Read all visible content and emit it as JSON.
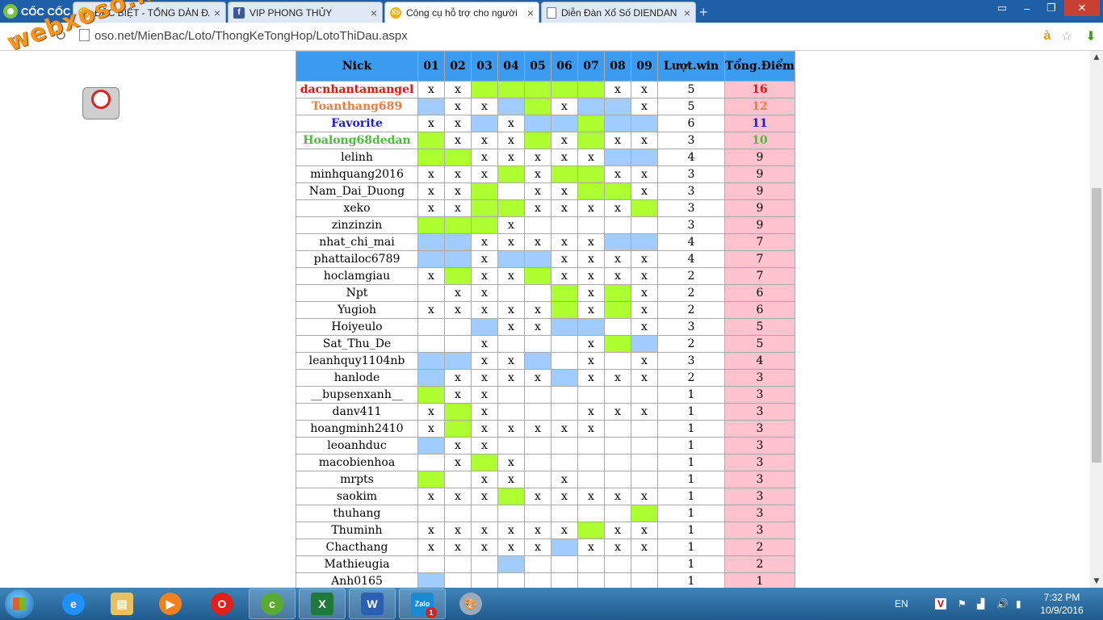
{
  "browser": {
    "brand_name": "CỐC CỐC",
    "tabs": [
      {
        "title": "ĐẶC BIỆT - TỔNG DÀN ĐẶ",
        "icon": "xoso-favicon-icon",
        "active": false
      },
      {
        "title": "VIP PHONG THỦY",
        "icon": "facebook-favicon-icon",
        "active": false
      },
      {
        "title": "Công cụ hỗ trợ cho người",
        "icon": "xoso-favicon-icon",
        "active": true
      },
      {
        "title": "Diễn Đàn Xổ Số DIENDAN",
        "icon": "page-icon",
        "active": false
      }
    ],
    "url": "oso.net/MienBac/Loto/ThongKeTongHop/LotoThiDau.aspx"
  },
  "watermark": "webxoso.net",
  "table": {
    "headers": [
      "Nick",
      "01",
      "02",
      "03",
      "04",
      "05",
      "06",
      "07",
      "08",
      "09",
      "Lượt.win",
      "Tổng.Điểm"
    ],
    "rows": [
      {
        "nick": "dacnhantamangel",
        "style": "red",
        "cells": [
          "x",
          "x",
          "",
          "",
          "",
          "",
          "",
          "x",
          "x"
        ],
        "fills": [
          "",
          "",
          "g",
          "g",
          "g",
          "g",
          "g",
          "",
          ""
        ],
        "win": "5",
        "points": "16"
      },
      {
        "nick": "Toanthang689",
        "style": "orange",
        "cells": [
          "",
          "x",
          "x",
          "",
          "",
          "x",
          "",
          "",
          "x"
        ],
        "fills": [
          "b",
          "",
          "",
          "b",
          "g",
          "",
          "b",
          "b",
          ""
        ],
        "win": "5",
        "points": "12"
      },
      {
        "nick": "Favorite",
        "style": "blue",
        "cells": [
          "x",
          "x",
          "",
          "x",
          "",
          "",
          "",
          "",
          ""
        ],
        "fills": [
          "",
          "",
          "b",
          "",
          "b",
          "b",
          "g",
          "b",
          "b"
        ],
        "win": "6",
        "points": "11"
      },
      {
        "nick": "Hoalong68dedan",
        "style": "green",
        "cells": [
          "",
          "x",
          "x",
          "x",
          "",
          "x",
          "",
          "x",
          "x"
        ],
        "fills": [
          "g",
          "",
          "",
          "",
          "g",
          "",
          "g",
          "",
          ""
        ],
        "win": "3",
        "points": "10"
      },
      {
        "nick": "lelinh",
        "style": "",
        "cells": [
          "",
          "",
          "x",
          "x",
          "x",
          "x",
          "x",
          "",
          ""
        ],
        "fills": [
          "g",
          "g",
          "",
          "",
          "",
          "",
          "",
          "b",
          "b"
        ],
        "win": "4",
        "points": "9"
      },
      {
        "nick": "minhquang2016",
        "style": "",
        "cells": [
          "x",
          "x",
          "x",
          "",
          "x",
          "",
          "",
          "x",
          "x"
        ],
        "fills": [
          "",
          "",
          "",
          "g",
          "",
          "g",
          "g",
          "",
          ""
        ],
        "win": "3",
        "points": "9"
      },
      {
        "nick": "Nam_Dai_Duong",
        "style": "",
        "cells": [
          "x",
          "x",
          "",
          "",
          "x",
          "x",
          "",
          "",
          "x"
        ],
        "fills": [
          "",
          "",
          "g",
          "",
          "",
          "",
          "g",
          "g",
          ""
        ],
        "win": "3",
        "points": "9"
      },
      {
        "nick": "xeko",
        "style": "",
        "cells": [
          "x",
          "x",
          "",
          "",
          "x",
          "x",
          "x",
          "x",
          ""
        ],
        "fills": [
          "",
          "",
          "g",
          "g",
          "",
          "",
          "",
          "",
          "g"
        ],
        "win": "3",
        "points": "9"
      },
      {
        "nick": "zinzinzin",
        "style": "",
        "cells": [
          "",
          "",
          "",
          "x",
          "",
          "",
          "",
          "",
          ""
        ],
        "fills": [
          "g",
          "g",
          "g",
          "",
          "",
          "",
          "",
          "",
          ""
        ],
        "win": "3",
        "points": "9"
      },
      {
        "nick": "nhat_chi_mai",
        "style": "",
        "cells": [
          "",
          "",
          "x",
          "x",
          "x",
          "x",
          "x",
          "",
          ""
        ],
        "fills": [
          "b",
          "b",
          "",
          "",
          "",
          "",
          "",
          "b",
          "b"
        ],
        "win": "4",
        "points": "7"
      },
      {
        "nick": "phattailoc6789",
        "style": "",
        "cells": [
          "",
          "",
          "x",
          "",
          "",
          "x",
          "x",
          "x",
          "x"
        ],
        "fills": [
          "b",
          "b",
          "",
          "b",
          "b",
          "",
          "",
          "",
          ""
        ],
        "win": "4",
        "points": "7"
      },
      {
        "nick": "hoclamgiau",
        "style": "",
        "cells": [
          "x",
          "",
          "x",
          "x",
          "",
          "x",
          "x",
          "x",
          "x"
        ],
        "fills": [
          "",
          "g",
          "",
          "",
          "g",
          "",
          "",
          "",
          ""
        ],
        "win": "2",
        "points": "7"
      },
      {
        "nick": "Npt",
        "style": "",
        "cells": [
          "",
          "x",
          "x",
          "",
          "",
          "",
          "x",
          "",
          "x"
        ],
        "fills": [
          "",
          "",
          "",
          "",
          "",
          "g",
          "",
          "g",
          ""
        ],
        "win": "2",
        "points": "6"
      },
      {
        "nick": "Yugioh",
        "style": "",
        "cells": [
          "x",
          "x",
          "x",
          "x",
          "x",
          "",
          "x",
          "",
          "x"
        ],
        "fills": [
          "",
          "",
          "",
          "",
          "",
          "g",
          "",
          "g",
          ""
        ],
        "win": "2",
        "points": "6"
      },
      {
        "nick": "Hoiyeulo",
        "style": "",
        "cells": [
          "",
          "",
          "",
          "x",
          "x",
          "",
          "",
          "",
          "x"
        ],
        "fills": [
          "",
          "",
          "b",
          "",
          "",
          "b",
          "b",
          "",
          ""
        ],
        "win": "3",
        "points": "5"
      },
      {
        "nick": "Sat_Thu_De",
        "style": "",
        "cells": [
          "",
          "",
          "x",
          "",
          "",
          "",
          "x",
          "",
          ""
        ],
        "fills": [
          "",
          "",
          "",
          "",
          "",
          "",
          "",
          "g",
          "b"
        ],
        "win": "2",
        "points": "5"
      },
      {
        "nick": "leanhquy1104nb",
        "style": "",
        "cells": [
          "",
          "",
          "x",
          "x",
          "",
          "",
          "x",
          "",
          "x"
        ],
        "fills": [
          "b",
          "b",
          "",
          "",
          "b",
          "",
          "",
          "",
          ""
        ],
        "win": "3",
        "points": "4"
      },
      {
        "nick": "hanlode",
        "style": "",
        "cells": [
          "",
          "x",
          "x",
          "x",
          "x",
          "",
          "x",
          "x",
          "x"
        ],
        "fills": [
          "b",
          "",
          "",
          "",
          "",
          "b",
          "",
          "",
          ""
        ],
        "win": "2",
        "points": "3"
      },
      {
        "nick": "__bupsenxanh__",
        "style": "",
        "cells": [
          "",
          "x",
          "x",
          "",
          "",
          "",
          "",
          "",
          ""
        ],
        "fills": [
          "g",
          "",
          "",
          "",
          "",
          "",
          "",
          "",
          ""
        ],
        "win": "1",
        "points": "3"
      },
      {
        "nick": "danv411",
        "style": "",
        "cells": [
          "x",
          "",
          "x",
          "",
          "",
          "",
          "x",
          "x",
          "x"
        ],
        "fills": [
          "",
          "g",
          "",
          "",
          "",
          "",
          "",
          "",
          ""
        ],
        "win": "1",
        "points": "3"
      },
      {
        "nick": "hoangminh2410",
        "style": "",
        "cells": [
          "x",
          "",
          "x",
          "x",
          "x",
          "x",
          "x",
          "",
          ""
        ],
        "fills": [
          "",
          "g",
          "",
          "",
          "",
          "",
          "",
          "",
          ""
        ],
        "win": "1",
        "points": "3"
      },
      {
        "nick": "leoanhduc",
        "style": "",
        "cells": [
          "",
          "x",
          "x",
          "",
          "",
          "",
          "",
          "",
          ""
        ],
        "fills": [
          "b",
          "",
          "",
          "",
          "",
          "",
          "",
          "",
          ""
        ],
        "win": "1",
        "points": "3"
      },
      {
        "nick": "macobienhoa",
        "style": "",
        "cells": [
          "",
          "x",
          "",
          "x",
          "",
          "",
          "",
          "",
          ""
        ],
        "fills": [
          "",
          "",
          "g",
          "",
          "",
          "",
          "",
          "",
          ""
        ],
        "win": "1",
        "points": "3"
      },
      {
        "nick": "mrpts",
        "style": "",
        "cells": [
          "",
          "",
          "x",
          "x",
          "",
          "x",
          "",
          "",
          ""
        ],
        "fills": [
          "g",
          "",
          "",
          "",
          "",
          "",
          "",
          "",
          ""
        ],
        "win": "1",
        "points": "3"
      },
      {
        "nick": "saokim",
        "style": "",
        "cells": [
          "x",
          "x",
          "x",
          "",
          "x",
          "x",
          "x",
          "x",
          "x"
        ],
        "fills": [
          "",
          "",
          "",
          "g",
          "",
          "",
          "",
          "",
          ""
        ],
        "win": "1",
        "points": "3"
      },
      {
        "nick": "thuhang",
        "style": "",
        "cells": [
          "",
          "",
          "",
          "",
          "",
          "",
          "",
          "",
          ""
        ],
        "fills": [
          "",
          "",
          "",
          "",
          "",
          "",
          "",
          "",
          "g"
        ],
        "win": "1",
        "points": "3"
      },
      {
        "nick": "Thuminh",
        "style": "",
        "cells": [
          "x",
          "x",
          "x",
          "x",
          "x",
          "x",
          "",
          "x",
          "x"
        ],
        "fills": [
          "",
          "",
          "",
          "",
          "",
          "",
          "g",
          "",
          ""
        ],
        "win": "1",
        "points": "3"
      },
      {
        "nick": "Chacthang",
        "style": "",
        "cells": [
          "x",
          "x",
          "x",
          "x",
          "x",
          "",
          "x",
          "x",
          "x"
        ],
        "fills": [
          "",
          "",
          "",
          "",
          "",
          "b",
          "",
          "",
          ""
        ],
        "win": "1",
        "points": "2"
      },
      {
        "nick": "Mathieugia",
        "style": "",
        "cells": [
          "",
          "",
          "",
          "",
          "",
          "",
          "",
          "",
          ""
        ],
        "fills": [
          "",
          "",
          "",
          "b",
          "",
          "",
          "",
          "",
          ""
        ],
        "win": "1",
        "points": "2"
      },
      {
        "nick": "Anh0165",
        "style": "",
        "cells": [
          "",
          "",
          "",
          "",
          "",
          "",
          "",
          "",
          ""
        ],
        "fills": [
          "b",
          "",
          "",
          "",
          "",
          "",
          "",
          "",
          ""
        ],
        "win": "1",
        "points": "1"
      }
    ]
  },
  "colors": {
    "header_bg": "#3a9bf0",
    "points_bg": "#ffc3cf",
    "green_fill": "#adff2f",
    "blue_fill": "#a0ccff",
    "nick_red": "#ee1111",
    "nick_orange": "#f07b3f",
    "nick_blue": "#1a1adb",
    "nick_green": "#4cbb3c"
  },
  "taskbar": {
    "apps": [
      "ie-icon",
      "explorer-icon",
      "media-player-icon",
      "opera-icon",
      "coccoc-icon",
      "excel-icon",
      "word-icon",
      "zalo-icon",
      "paint-icon"
    ],
    "zalo_label": "Zalo",
    "zalo_badge": "1",
    "language": "EN",
    "time": "7:32 PM",
    "date": "10/9/2016"
  }
}
